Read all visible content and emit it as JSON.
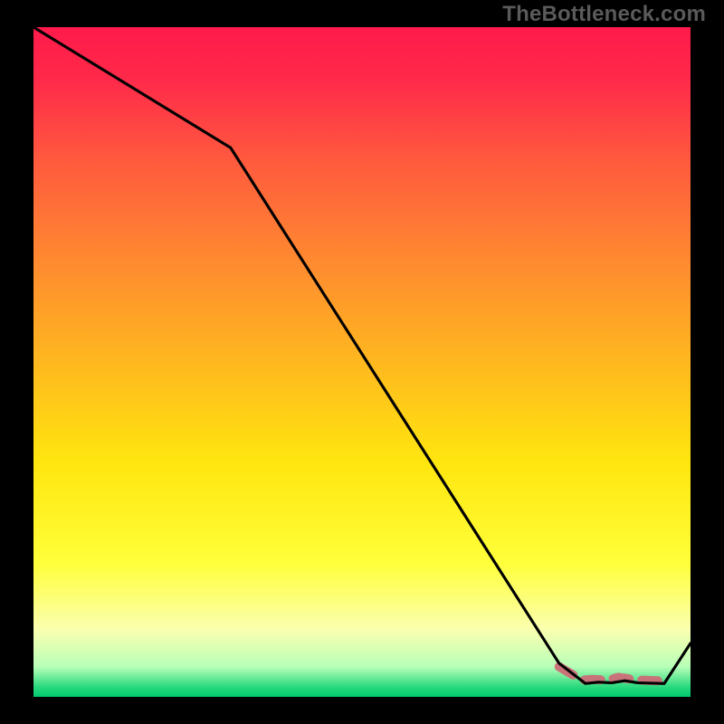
{
  "watermark": "TheBottleneck.com",
  "chart_data": {
    "type": "line",
    "title": "",
    "xlabel": "",
    "ylabel": "",
    "xlim": [
      0,
      100
    ],
    "ylim": [
      0,
      100
    ],
    "grid": false,
    "series": [
      {
        "name": "curve",
        "x": [
          0,
          30,
          80,
          84,
          86,
          88,
          90,
          92,
          96,
          100
        ],
        "y": [
          100,
          82,
          5,
          2,
          2.2,
          2.1,
          2.4,
          2.1,
          2.0,
          8
        ]
      }
    ],
    "marker_points": {
      "name": "flat-segment",
      "x": [
        80,
        83.5,
        85,
        87.5,
        89,
        90.5,
        92,
        95
      ],
      "y": [
        4.5,
        2.5,
        2.6,
        2.5,
        2.9,
        2.7,
        2.5,
        2.4
      ]
    },
    "gradient_stops": [
      {
        "offset": 0.0,
        "color": "#ff1a4b"
      },
      {
        "offset": 0.08,
        "color": "#ff2a4a"
      },
      {
        "offset": 0.2,
        "color": "#ff5a3e"
      },
      {
        "offset": 0.35,
        "color": "#ff8a30"
      },
      {
        "offset": 0.5,
        "color": "#ffb81f"
      },
      {
        "offset": 0.65,
        "color": "#ffe60f"
      },
      {
        "offset": 0.8,
        "color": "#ffff3a"
      },
      {
        "offset": 0.9,
        "color": "#faffb0"
      },
      {
        "offset": 0.955,
        "color": "#b8ffb8"
      },
      {
        "offset": 0.985,
        "color": "#2bd97e"
      },
      {
        "offset": 1.0,
        "color": "#00c96e"
      }
    ],
    "marker_color": "#cc6b77",
    "line_color": "#000000",
    "plot_bg_frame": "#000000"
  }
}
